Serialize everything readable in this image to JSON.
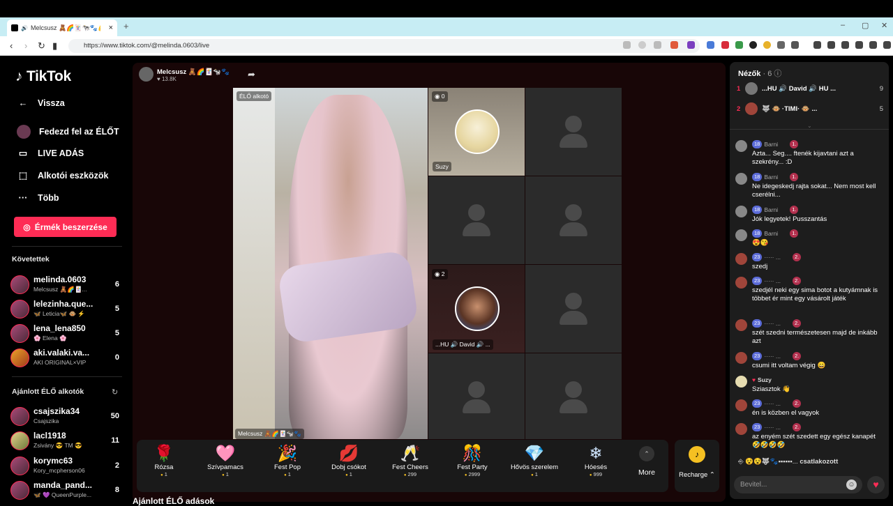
{
  "browser": {
    "tab_title": "Melcsusz 🧸🌈🃏🐄🐾💪",
    "url": "https://www.tiktok.com/@melinda.0603/live"
  },
  "sidebar": {
    "logo": "TikTok",
    "nav": [
      {
        "label": "Vissza",
        "icon": "arrow-left-icon"
      },
      {
        "label": "Fedezd fel az ÉLŐT",
        "icon": "live-explore-icon"
      },
      {
        "label": "LIVE ADÁS",
        "icon": "live-broadcast-icon"
      },
      {
        "label": "Alkotói eszközök",
        "icon": "creator-tools-icon"
      },
      {
        "label": "Több",
        "icon": "more-icon"
      }
    ],
    "coins_button": "Érmék beszerzése",
    "following_heading": "Követettek",
    "following": [
      {
        "name": "melinda.0603",
        "sub": "Melcsusz 🧸🌈🃏...",
        "count": "6"
      },
      {
        "name": "lelezinha.que...",
        "sub": "🦋 Leticia🦋 🐵 ⚡",
        "count": "5"
      },
      {
        "name": "lena_lena850",
        "sub": "🌸 Elena 🌸",
        "count": "5"
      },
      {
        "name": "aki.valaki.va...",
        "sub": "AKI ORIGINAL×VIP",
        "count": "0"
      }
    ],
    "recommended_heading": "Ajánlott ÉLŐ alkotók",
    "recommended": [
      {
        "name": "csajszika34",
        "sub": "Csajszika",
        "count": "50"
      },
      {
        "name": "lacl1918",
        "sub": "Zsivány 😎 TM 😎",
        "count": "11"
      },
      {
        "name": "korymc63",
        "sub": "Kory_mcpherson06",
        "count": "2"
      },
      {
        "name": "manda_pand...",
        "sub": "🦋 💜 QueenPurple...",
        "count": "8"
      }
    ]
  },
  "stream": {
    "host_name": "Melcsusz 🧸🌈🃏🐄🐾",
    "host_likes": "♥ 13.8K",
    "host_badge": "ÉLŐ alkotó",
    "host_caption": "Melcsusz 🧸🌈🃏🐄🐾",
    "guests": [
      {
        "name": "Suzy",
        "count": "0"
      },
      {
        "name": "...HU 🔊 David 🔊 ...",
        "count": "2"
      }
    ]
  },
  "gifts": [
    {
      "name": "Rózsa",
      "price": "1",
      "icon": "🌹"
    },
    {
      "name": "Szívpamacs",
      "price": "1",
      "icon": "🩷"
    },
    {
      "name": "Fest Pop",
      "price": "1",
      "icon": "🎉"
    },
    {
      "name": "Dobj csókot",
      "price": "1",
      "icon": "💋"
    },
    {
      "name": "Fest Cheers",
      "price": "299",
      "icon": "🥂"
    },
    {
      "name": "Fest Party",
      "price": "2999",
      "icon": "🎊"
    },
    {
      "name": "Hővös szerelem",
      "price": "1",
      "icon": "💎"
    },
    {
      "name": "Hóesés",
      "price": "999",
      "icon": "❄"
    }
  ],
  "gift_more": "More",
  "recharge": "Recharge ⌃",
  "recommended_lives_title": "Ajánlott ÉLŐ adások",
  "chat": {
    "viewers_title": "Nézők",
    "viewers_count": "· 6",
    "viewers": [
      {
        "rank": "1",
        "name": "...HU 🔊 David 🔊 HU ...",
        "score": "9"
      },
      {
        "rank": "2",
        "name": "🐺 🐵 ·TIMI· 🐵 ...",
        "score": "5"
      }
    ],
    "messages": [
      {
        "user": "Barni",
        "level": "18",
        "rank": "1.",
        "text": "Azta... Seg.... ftenék kijavtani azt a szekrény... :D"
      },
      {
        "user": "Barni",
        "level": "18",
        "rank": "1.",
        "text": "Ne idegeskedj rajta sokat... Nem most kell cserélni..."
      },
      {
        "user": "Barni",
        "level": "18",
        "rank": "1.",
        "text": "Jók legyetek! Pusszantás"
      },
      {
        "user": "Barni",
        "level": "18",
        "rank": "1.",
        "text": "😍😘"
      },
      {
        "user": "····· ...",
        "level": "23",
        "rank": "2.",
        "text": "szedj"
      },
      {
        "user": "····· ...",
        "level": "23",
        "rank": "2.",
        "text": "szedjél neki egy sima botot a kutyámnak is többet ér mint egy vásárolt játék"
      },
      {
        "user": "····· ...",
        "level": "23",
        "rank": "2.",
        "text": "szét szedni természetesen majd de inkább azt"
      },
      {
        "user": "····· ...",
        "level": "23",
        "rank": "2.",
        "text": "csumi itt voltam végig 😄"
      },
      {
        "user": "Suzy",
        "level": "",
        "rank": "",
        "text": "Sziasztok 👋"
      },
      {
        "user": "····· ...",
        "level": "23",
        "rank": "2.",
        "text": "én is közben el vagyok"
      },
      {
        "user": "····· ...",
        "level": "23",
        "rank": "2.",
        "text": "az enyém szét szedett egy egész kanapét🤣🤣🤣🤣"
      }
    ],
    "joined_user": "😵😵🐺🐾▪▪▪▪▪▪...",
    "joined_text": "csatlakozott",
    "input_placeholder": "Bevitel..."
  },
  "colors": {
    "accent": "#fe2c55",
    "stream_bg": "#180607",
    "chat_bg": "#1d1d1d",
    "coin": "#f5c022"
  }
}
